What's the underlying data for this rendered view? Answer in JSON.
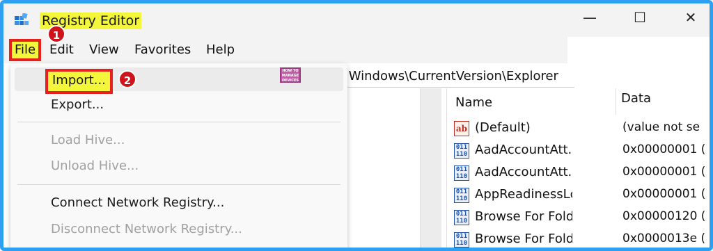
{
  "window": {
    "title": "Registry Editor",
    "minimize": "—",
    "maximize": "☐",
    "close": "✕"
  },
  "menu": {
    "items": [
      "File",
      "Edit",
      "View",
      "Favorites",
      "Help"
    ]
  },
  "badges": [
    "1",
    "2"
  ],
  "address": ".Windows\\CurrentVersion\\Explorer",
  "file_menu": {
    "import": "Import...",
    "export": "Export...",
    "load_hive": "Load Hive...",
    "unload_hive": "Unload Hive...",
    "connect": "Connect Network Registry...",
    "disconnect": "Disconnect Network Registry..."
  },
  "logo_text": "HOW TO MANAGE DEVICES",
  "values": {
    "headers": {
      "name": "Name",
      "data": "Data"
    },
    "rows": [
      {
        "icon": "string-value-icon",
        "name": "(Default)",
        "data": "(value not se"
      },
      {
        "icon": "dword-value-icon",
        "name": "AadAccountAtt.",
        "data": "0x00000001 ("
      },
      {
        "icon": "dword-value-icon",
        "name": "AadAccountAtt.",
        "data": "0x00000001 ("
      },
      {
        "icon": "dword-value-icon",
        "name": "AppReadinessLc",
        "data": "0x00000001 ("
      },
      {
        "icon": "dword-value-icon",
        "name": "Browse For Fold",
        "data": "0x00000120 ("
      },
      {
        "icon": "dword-value-icon",
        "name": "Browse For Fold",
        "data": "0x0000013e ("
      }
    ]
  },
  "colors": {
    "frame_border": "#2f9ff2",
    "highlight_yellow": "#f3f63a",
    "highlight_red": "#e8201c",
    "badge_red": "#d0131a"
  }
}
